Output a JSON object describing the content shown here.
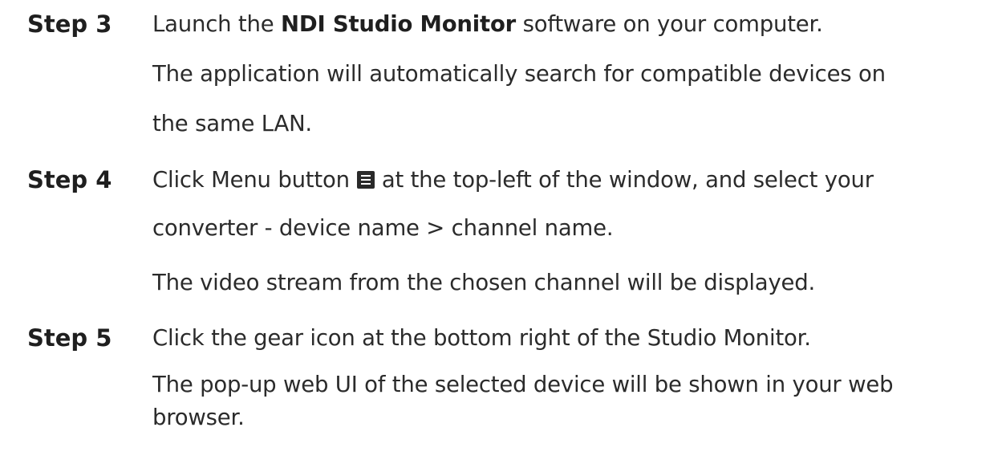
{
  "steps": [
    {
      "label": "Step 3",
      "instruction": {
        "prefix": "Launch the ",
        "bold": "NDI Studio Monitor",
        "suffix": " software on your computer."
      },
      "result": [
        "The application will automatically search for compatible devices on",
        "the same LAN."
      ]
    },
    {
      "label": "Step 4",
      "instruction": {
        "prefix": "Click Menu button",
        "icon": "menu-icon",
        "suffix": "at the top-left of the window, and select your",
        "line2": "converter - device name > channel name."
      },
      "result": [
        "The video stream from the chosen channel will be displayed."
      ]
    },
    {
      "label": "Step 5",
      "instruction": {
        "text": "Click the gear icon at the bottom right of the Studio Monitor."
      },
      "result": [
        "The pop-up web UI of the selected device will be shown in your web",
        "browser."
      ]
    }
  ]
}
